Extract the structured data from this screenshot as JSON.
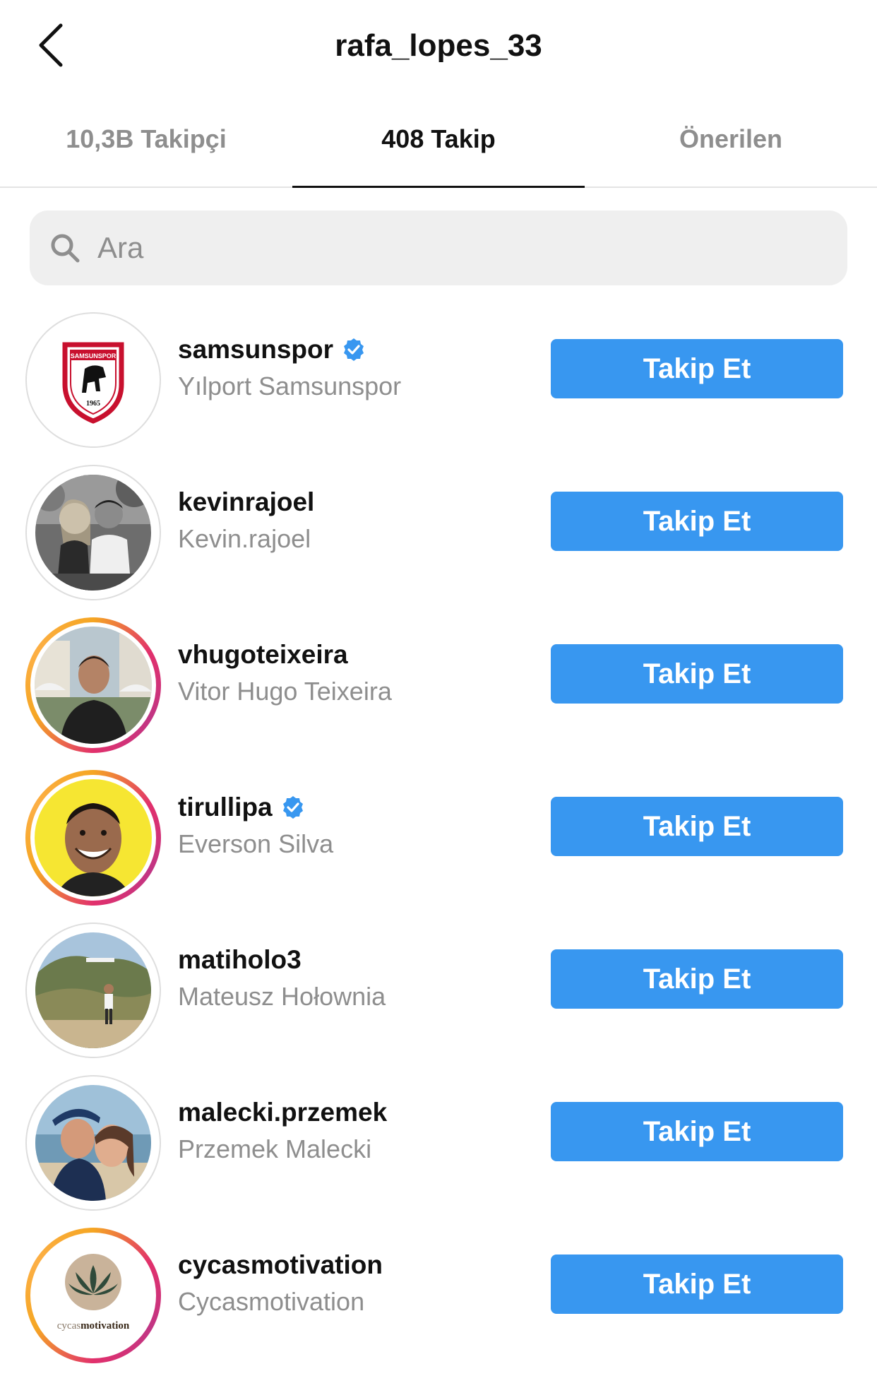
{
  "header": {
    "title": "rafa_lopes_33"
  },
  "tabs": [
    {
      "label": "10,3B Takipçi",
      "active": false
    },
    {
      "label": "408 Takip",
      "active": true
    },
    {
      "label": "Önerilen",
      "active": false
    }
  ],
  "search": {
    "placeholder": "Ara",
    "value": ""
  },
  "colors": {
    "button_blue": "#3897f0",
    "verified_blue": "#3897f0",
    "secondary_text": "#8e8e8e",
    "search_bg": "#efefef"
  },
  "users": [
    {
      "username": "samsunspor",
      "full_name": "Yılport Samsunspor",
      "verified": true,
      "story_ring": false,
      "button": "Takip Et",
      "avatar": "samsunspor-logo",
      "logo_text": "SAMSUNSPOR",
      "logo_year": "1965"
    },
    {
      "username": "kevinrajoel",
      "full_name": "Kevin.rajoel",
      "verified": false,
      "story_ring": false,
      "button": "Takip Et",
      "avatar": "couple-photo-bw"
    },
    {
      "username": "vhugoteixeira",
      "full_name": "Vitor Hugo Teixeira",
      "verified": false,
      "story_ring": true,
      "button": "Takip Et",
      "avatar": "man-photo"
    },
    {
      "username": "tirullipa",
      "full_name": "Everson Silva",
      "verified": true,
      "story_ring": true,
      "button": "Takip Et",
      "avatar": "smiling-man-yellow"
    },
    {
      "username": "matiholo3",
      "full_name": "Mateusz Hołownia",
      "verified": false,
      "story_ring": false,
      "button": "Takip Et",
      "avatar": "hollywood-hills-photo"
    },
    {
      "username": "malecki.przemek",
      "full_name": "Przemek Malecki",
      "verified": false,
      "story_ring": false,
      "button": "Takip Et",
      "avatar": "couple-beach-photo"
    },
    {
      "username": "cycasmotivation",
      "full_name": "Cycasmotivation",
      "verified": false,
      "story_ring": true,
      "button": "Takip Et",
      "avatar": "lotus-logo",
      "logo_text_light": "cycas",
      "logo_text_bold": "motivation"
    }
  ]
}
